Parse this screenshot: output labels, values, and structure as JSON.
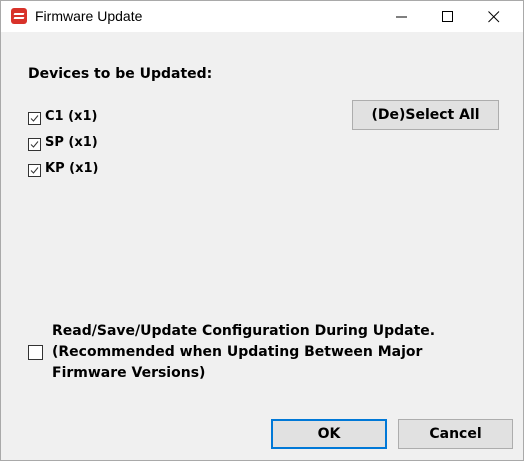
{
  "window": {
    "title": "Firmware Update"
  },
  "devices": {
    "heading": "Devices to be Updated:",
    "items": [
      {
        "label": "C1 (x1)",
        "checked": true
      },
      {
        "label": "SP (x1)",
        "checked": true
      },
      {
        "label": "KP (x1)",
        "checked": true
      }
    ],
    "deselect_all_label": "(De)Select All"
  },
  "config_option": {
    "lines": [
      "Read/Save/Update Configuration During Update.",
      "(Recommended when Updating Between Major",
      "Firmware Versions)"
    ],
    "checked": false
  },
  "footer": {
    "ok_label": "OK",
    "cancel_label": "Cancel"
  },
  "colors": {
    "accent": "#0078d7",
    "app_icon": "#d8322a",
    "button_face": "#e1e1e1",
    "window_background": "#f0f0f0"
  },
  "icons": {
    "app": "app-logo-icon",
    "minimize": "minimize-icon",
    "maximize": "maximize-icon",
    "close": "close-icon",
    "checkmark": "checkmark-icon"
  }
}
